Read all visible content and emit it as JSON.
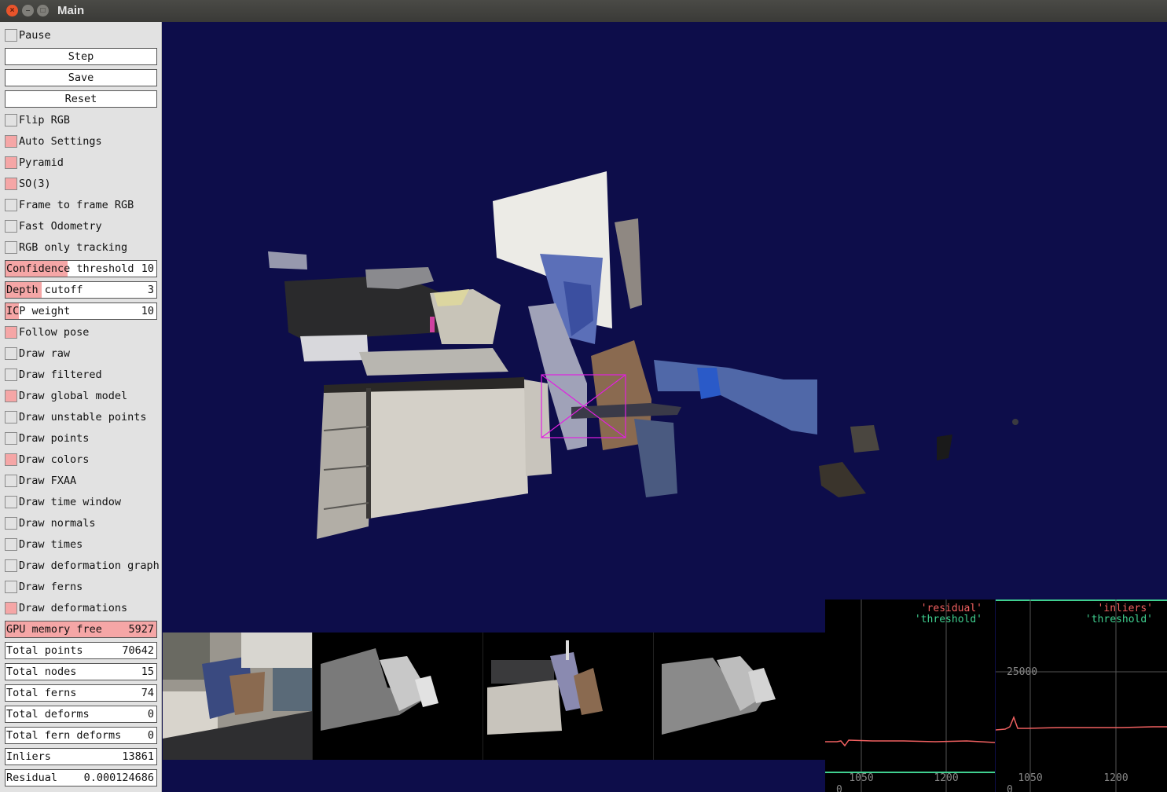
{
  "window": {
    "title": "Main"
  },
  "panel": {
    "pause": {
      "label": "Pause",
      "checked": false
    },
    "step_label": "Step",
    "save_label": "Save",
    "reset_label": "Reset",
    "flip_rgb": {
      "label": "Flip RGB",
      "checked": false
    },
    "auto_settings": {
      "label": "Auto Settings",
      "checked": true
    },
    "pyramid": {
      "label": "Pyramid",
      "checked": true
    },
    "so3": {
      "label": "SO(3)",
      "checked": true
    },
    "frame_to_frame_rgb": {
      "label": "Frame to frame RGB",
      "checked": false
    },
    "fast_odometry": {
      "label": "Fast Odometry",
      "checked": false
    },
    "rgb_only_tracking": {
      "label": "RGB only tracking",
      "checked": false
    },
    "confidence_threshold": {
      "label": "Confidence threshold",
      "value": "10",
      "fraction": 0.41
    },
    "depth_cutoff": {
      "label": "Depth cutoff",
      "value": "3",
      "fraction": 0.24
    },
    "icp_weight": {
      "label": "ICP weight",
      "value": "10",
      "fraction": 0.09
    },
    "follow_pose": {
      "label": "Follow pose",
      "checked": true
    },
    "draw_raw": {
      "label": "Draw raw",
      "checked": false
    },
    "draw_filtered": {
      "label": "Draw filtered",
      "checked": false
    },
    "draw_global_model": {
      "label": "Draw global model",
      "checked": true
    },
    "draw_unstable_points": {
      "label": "Draw unstable points",
      "checked": false
    },
    "draw_points": {
      "label": "Draw points",
      "checked": false
    },
    "draw_colors": {
      "label": "Draw colors",
      "checked": true
    },
    "draw_fxaa": {
      "label": "Draw FXAA",
      "checked": false
    },
    "draw_time_window": {
      "label": "Draw time window",
      "checked": false
    },
    "draw_normals": {
      "label": "Draw normals",
      "checked": false
    },
    "draw_times": {
      "label": "Draw times",
      "checked": false
    },
    "draw_deformation_graph": {
      "label": "Draw deformation graph",
      "checked": false
    },
    "draw_ferns": {
      "label": "Draw ferns",
      "checked": false
    },
    "draw_deformations": {
      "label": "Draw deformations",
      "checked": true
    },
    "gpu_memory_free": {
      "label": "GPU memory free",
      "value": "5927"
    },
    "total_points": {
      "label": "Total points",
      "value": "70642"
    },
    "total_nodes": {
      "label": "Total nodes",
      "value": "15"
    },
    "total_ferns": {
      "label": "Total ferns",
      "value": "74"
    },
    "total_deforms": {
      "label": "Total deforms",
      "value": "0"
    },
    "total_fern_deforms": {
      "label": "Total fern deforms",
      "value": "0"
    },
    "inliers": {
      "label": "Inliers",
      "value": "13861"
    },
    "residual": {
      "label": "Residual",
      "value": "0.000124686"
    }
  },
  "colors": {
    "background": "#0d0d4a",
    "checked": "#f5a6a6",
    "residual_line": "#f06060",
    "threshold_line": "#40d090"
  },
  "plots": {
    "residual": {
      "legend_series": "'residual'",
      "legend_threshold": "'threshold'",
      "ticks_x": [
        "1050",
        "1200"
      ],
      "tick_y_bottom": "0"
    },
    "inliers": {
      "legend_series": "'inliers'",
      "legend_threshold": "'threshold'",
      "ticks_x": [
        "1050",
        "1200"
      ],
      "tick_y": "25000",
      "tick_y_bottom": "0"
    }
  }
}
